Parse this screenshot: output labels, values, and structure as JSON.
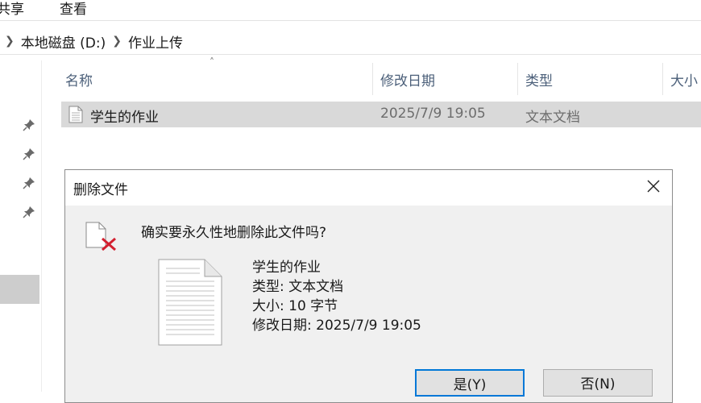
{
  "ribbon": {
    "tabs": [
      "共享",
      "查看"
    ]
  },
  "address_bar": {
    "segments": [
      "本地磁盘 (D:)",
      "作业上传"
    ]
  },
  "columns": {
    "name": "名称",
    "modified": "修改日期",
    "type": "类型",
    "size": "大小"
  },
  "files": [
    {
      "name": "学生的作业",
      "modified": "2025/7/9 19:05",
      "type": "文本文档"
    }
  ],
  "dialog": {
    "title": "删除文件",
    "question": "确实要永久性地删除此文件吗?",
    "file_name": "学生的作业",
    "file_type_line": "类型: 文本文档",
    "file_size_line": "大小: 10 字节",
    "file_modified_line": "修改日期: 2025/7/9 19:05",
    "yes_label": "是(Y)",
    "no_label": "否(N)"
  },
  "colors": {
    "accent": "#0078d7",
    "delete_x": "#d32030",
    "selection": "#d9d9d9"
  },
  "icons": [
    "pin-icon",
    "text-file-icon",
    "delete-file-icon",
    "close-icon",
    "chevron-right-icon",
    "sort-up-icon"
  ]
}
